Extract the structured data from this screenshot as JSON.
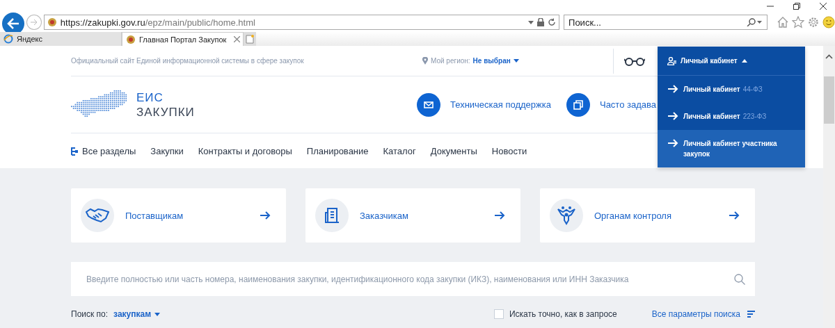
{
  "browser": {
    "address": {
      "host": "https://zakupki.gov.ru",
      "path": "/epz/main/public/home.html"
    },
    "search": {
      "placeholder": "Поиск..."
    },
    "tabs": [
      {
        "label": "Яндекс",
        "selected": false
      },
      {
        "label": "Главная Портал Закупок",
        "selected": true
      }
    ]
  },
  "topbar": {
    "tagline": "Официальный сайт Единой информационной системы в сфере закупок",
    "region_label": "Мой регион:",
    "region_value": "Не выбран"
  },
  "account_menu": {
    "label": "Личный кабинет",
    "expanded": true,
    "items": [
      {
        "label": "Личный кабинет",
        "law": "44-ФЗ",
        "selected": false
      },
      {
        "label": "Личный кабинет",
        "law": "223-ФЗ",
        "selected": false
      },
      {
        "label": "Личный кабинет участника закупок",
        "selected": true
      }
    ]
  },
  "header": {
    "logo_top": "ЕИС",
    "logo_bottom": "ЗАКУПКИ",
    "links": [
      {
        "kind": "mail",
        "label": "Техническая поддержка"
      },
      {
        "kind": "copy",
        "label": "Часто задава"
      }
    ]
  },
  "nav": [
    {
      "label": "Все разделы",
      "kind": "sections"
    },
    {
      "label": "Закупки"
    },
    {
      "label": "Контракты и договоры"
    },
    {
      "label": "Планирование"
    },
    {
      "label": "Каталог"
    },
    {
      "label": "Документы"
    },
    {
      "label": "Новости"
    }
  ],
  "cards": [
    {
      "kind": "handshake",
      "label": "Поставщикам"
    },
    {
      "kind": "building",
      "label": "Заказчикам"
    },
    {
      "kind": "emblem",
      "label": "Органам контроля"
    }
  ],
  "search": {
    "placeholder": "Введите полностью или часть номера, наименования закупки, идентификационного кода закупки (ИКЗ), наименования или ИНН Заказчика"
  },
  "filters": {
    "search_by_label": "Поиск по:",
    "search_by_value": "закупкам",
    "exact": {
      "label": "Искать точно, как в запросе",
      "checked": false
    },
    "all_params": "Все параметры поиска"
  }
}
